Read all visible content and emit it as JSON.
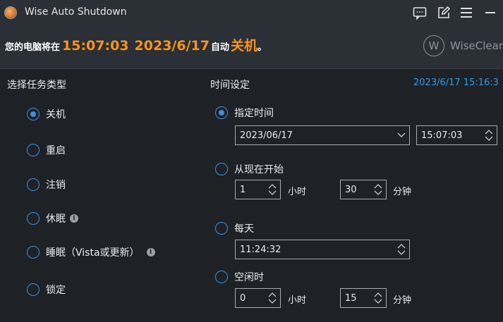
{
  "app": {
    "title": "Wise Auto Shutdown"
  },
  "banner": {
    "prefix": "您的电脑将在",
    "time": "15:07:03",
    "date": "2023/6/17",
    "middle": "自动",
    "action": "关机",
    "suffix": "。",
    "brand": "WiseClear",
    "brand_logo": "W"
  },
  "task_type": {
    "label": "选择任务类型",
    "options": [
      {
        "label": "关机",
        "selected": true
      },
      {
        "label": "重启",
        "selected": false
      },
      {
        "label": "注销",
        "selected": false
      },
      {
        "label": "休眠",
        "selected": false
      },
      {
        "label": "睡眠（Vista或更新）",
        "selected": false
      },
      {
        "label": "锁定",
        "selected": false
      }
    ]
  },
  "time_settings": {
    "label": "时间设定",
    "current_clock": "2023/6/17 15:16:3",
    "specified": {
      "label": "指定时间",
      "selected": true,
      "date": "2023/06/17",
      "time": "15:07:03"
    },
    "from_now": {
      "label": "从现在开始",
      "selected": false,
      "hours": "1",
      "hours_unit": "小时",
      "minutes": "30",
      "minutes_unit": "分钟"
    },
    "daily": {
      "label": "每天",
      "selected": false,
      "time": "11:24:32"
    },
    "idle": {
      "label": "空闲时",
      "selected": false,
      "hours": "0",
      "hours_unit": "小时",
      "minutes": "15",
      "minutes_unit": "分钟"
    }
  },
  "colors": {
    "accent_orange": "#f7941d",
    "accent_blue": "#3d8fe0",
    "clock_blue": "#2e9ae6",
    "background": "#1e2126",
    "header": "#2b2f36"
  },
  "icons": [
    "app-logo-icon",
    "feedback-icon",
    "edit-icon",
    "menu-icon",
    "minimize-icon",
    "info-icon",
    "chevron-down-icon",
    "spinner-up-icon",
    "spinner-down-icon"
  ]
}
